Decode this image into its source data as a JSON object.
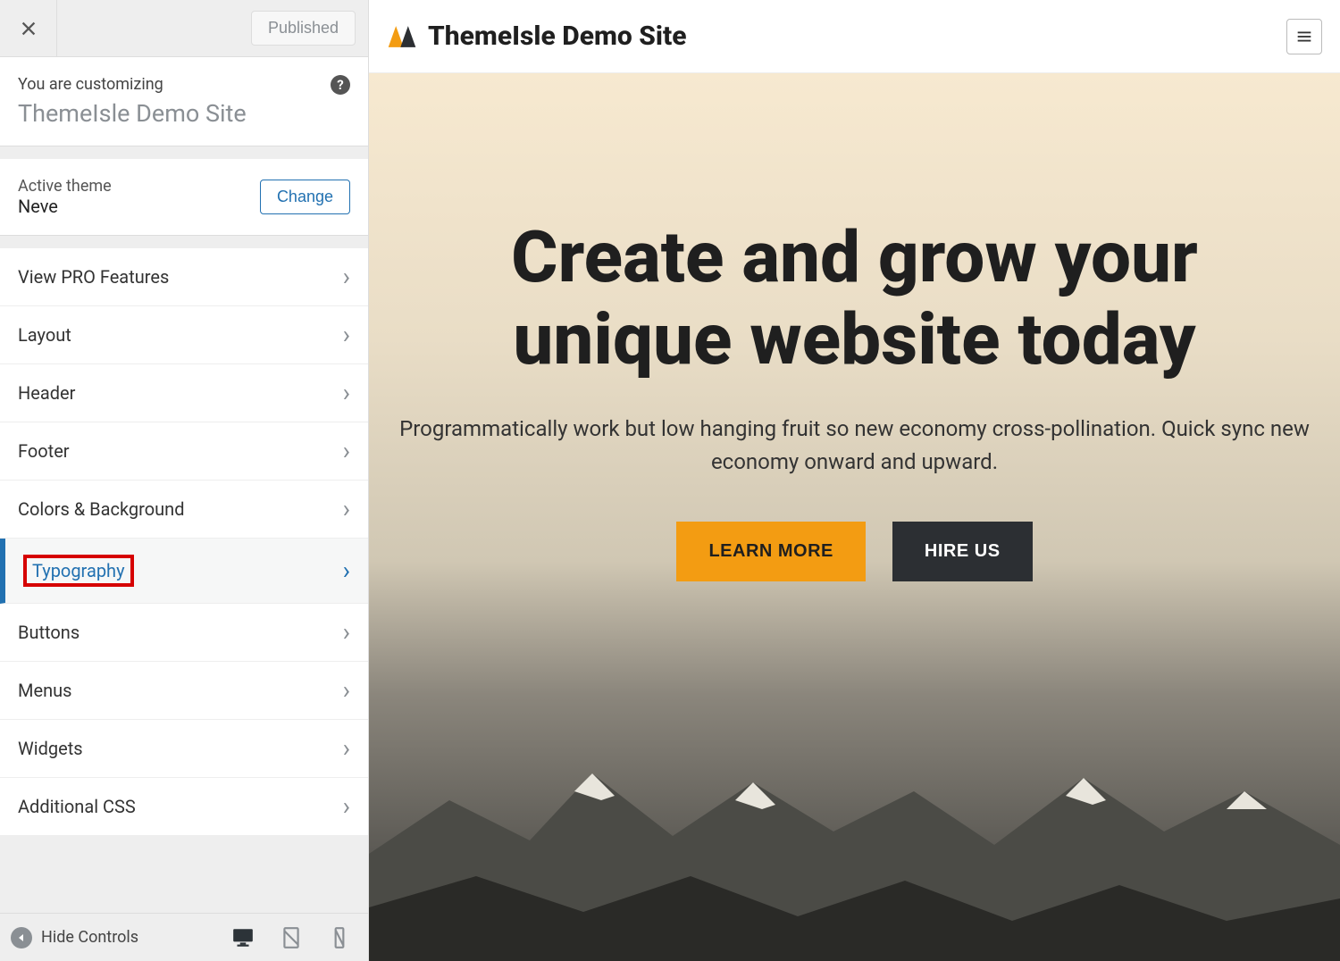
{
  "sidebar": {
    "published_label": "Published",
    "context_label": "You are customizing",
    "context_site": "ThemeIsle Demo Site",
    "active_theme_label": "Active theme",
    "active_theme_name": "Neve",
    "change_label": "Change",
    "hide_controls_label": "Hide Controls",
    "items": [
      {
        "label": "View PRO Features"
      },
      {
        "label": "Layout"
      },
      {
        "label": "Header"
      },
      {
        "label": "Footer"
      },
      {
        "label": "Colors & Background"
      },
      {
        "label": "Typography"
      },
      {
        "label": "Buttons"
      },
      {
        "label": "Menus"
      },
      {
        "label": "Widgets"
      },
      {
        "label": "Additional CSS"
      }
    ],
    "active_item_index": 5,
    "highlighted_item_index": 5
  },
  "preview": {
    "brand_name": "ThemeIsle Demo Site",
    "hero_heading": "Create and grow your unique website today",
    "hero_sub_line1": "Programmatically work but low hanging fruit so new economy cross-pollination. Quick sync new",
    "hero_sub_line2": "economy onward and upward.",
    "cta_primary": "LEARN MORE",
    "cta_secondary": "HIRE US"
  },
  "colors": {
    "accent": "#2271b1",
    "cta_primary_bg": "#f39c12",
    "cta_secondary_bg": "#2c2f33"
  }
}
